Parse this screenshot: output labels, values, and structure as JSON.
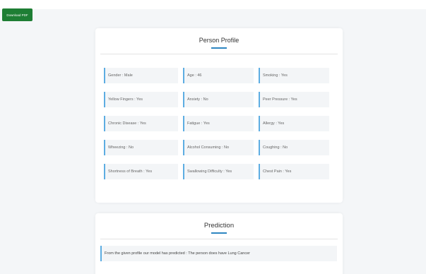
{
  "toolbar": {
    "download_label": "Download PDF"
  },
  "profile": {
    "title": "Person Profile",
    "fields": [
      "Gender : Male",
      "Age : 46",
      "Smoking : Yes",
      "Yellow Fingers : Yes",
      "Anxiety : No",
      "Peer Pressure : Yes",
      "Chronic Disease : Yes",
      "Fatigue : Yes",
      "Allergy : Yes",
      "Wheezing : No",
      "Alcohol Consuming : No",
      "Coughing : No",
      "Shortness of Breath : Yes",
      "Swallowing Difficulty : Yes",
      "Chest Pain : Yes"
    ]
  },
  "prediction": {
    "title": "Prediction",
    "text": "From the given profile our model has predicted : The person does have Lung Cancer"
  },
  "colors": {
    "background": "#f4f6f8",
    "button": "#1e7e34",
    "accent": "#2e86c1",
    "field_border": "#5dade2"
  }
}
